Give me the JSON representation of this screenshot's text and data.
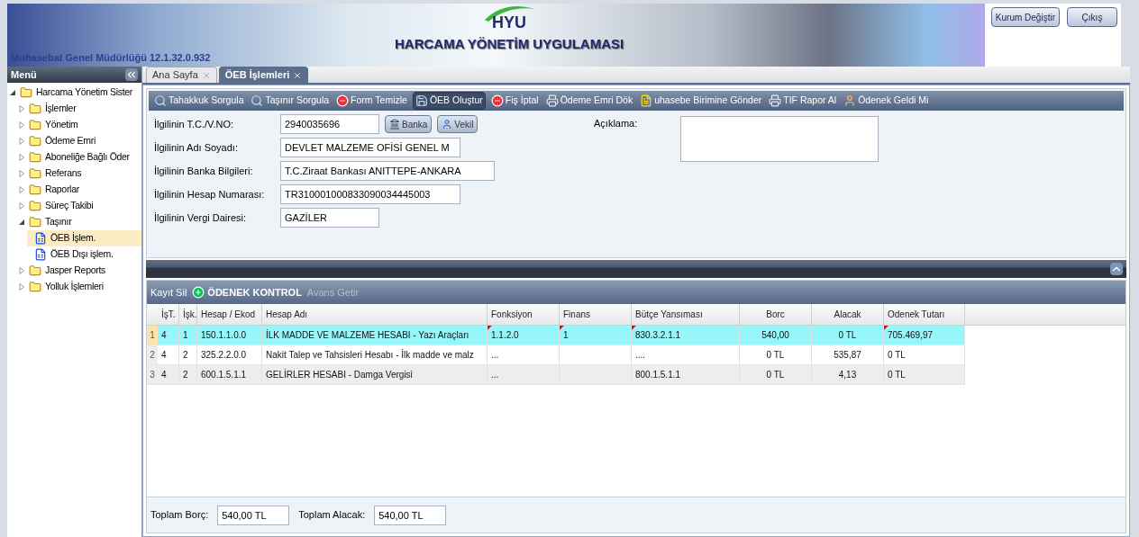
{
  "header": {
    "org": "Muhasebat Genel Müdürlüğü 12.1.32.0.932",
    "logo": "HYU",
    "title": "HARCAMA YÖNETİM UYGULAMASI",
    "buttons": [
      "Kurum Değiştir",
      "Çıkış"
    ]
  },
  "sidebar": {
    "title": "Menü",
    "items": [
      {
        "label": "Harcama Yönetim Sister",
        "expanded": true,
        "selected": false,
        "children": [
          {
            "label": "İşlemler",
            "expanded": false,
            "selected": false
          },
          {
            "label": "Yönetim",
            "expanded": false,
            "selected": false
          },
          {
            "label": "Ödeme Emri",
            "expanded": false,
            "selected": false
          },
          {
            "label": "Aboneliğe Bağlı Öder",
            "expanded": false,
            "selected": false
          },
          {
            "label": "Referans",
            "expanded": false,
            "selected": false
          },
          {
            "label": "Raporlar",
            "expanded": false,
            "selected": false
          },
          {
            "label": "Süreç Takibi",
            "expanded": false,
            "selected": false
          },
          {
            "label": "Taşınır",
            "expanded": true,
            "selected": false,
            "children": [
              {
                "label": "ÖEB İşlem.",
                "kind": "leaf",
                "selected": true
              },
              {
                "label": "ÖEB Dışı işlem.",
                "kind": "leaf",
                "selected": false
              }
            ]
          },
          {
            "label": "Jasper Reports",
            "expanded": false,
            "selected": false
          },
          {
            "label": "Yolluk İşlemleri",
            "expanded": false,
            "selected": false
          }
        ]
      }
    ]
  },
  "tabs": [
    {
      "label": "Ana Sayfa",
      "selected": false
    },
    {
      "label": "ÖEB İşlemleri",
      "selected": true
    }
  ],
  "toolbar": [
    {
      "label": "Tahakkuk Sorgula",
      "kind": "search",
      "selected": false
    },
    {
      "label": "Taşınır Sorgula",
      "kind": "search",
      "selected": false
    },
    {
      "label": "Form Temizle",
      "kind": "remove",
      "selected": false
    },
    {
      "label": "ÖEB Oluştur",
      "kind": "save",
      "selected": true
    },
    {
      "label": "Fiş İptal",
      "kind": "remove",
      "selected": false
    },
    {
      "label": "Ödeme Emri Dök",
      "kind": "print",
      "selected": false
    },
    {
      "label": "uhasebe Birimine Gönder",
      "kind": "document",
      "selected": false
    },
    {
      "label": "TIF Rapor Al",
      "kind": "print",
      "selected": false
    },
    {
      "label": "Ödenek Geldi Mi",
      "kind": "person",
      "selected": false
    }
  ],
  "form": {
    "fields": [
      {
        "label": "İlgilinin T.C./V.NO:",
        "value": "2940035696"
      },
      {
        "label": "İlgilinin Adı Soyadı:",
        "value": "DEVLET MALZEME OFİSİ GENEL M"
      },
      {
        "label": "İlgilinin Banka Bilgileri:",
        "value": "T.C.Ziraat Bankası ANITTEPE-ANKARA"
      },
      {
        "label": "İlgilinin Hesap Numarası:",
        "value": "TR310001000833090034445003"
      },
      {
        "label": "İlgilinin Vergi Dairesi:",
        "value": "GAZİLER"
      }
    ],
    "field_buttons": [
      {
        "label": "Banka",
        "kind": "bank"
      },
      {
        "label": "Vekil",
        "kind": "person"
      }
    ],
    "note": {
      "label": "Açıklama:"
    }
  },
  "grid_toolbar": [
    {
      "label": "Kayıt Sil",
      "kind": "text",
      "disabled": false
    },
    {
      "label": "ÖDENEK KONTROL",
      "kind": "add",
      "disabled": false
    },
    {
      "label": "Avans Getir",
      "kind": "text",
      "disabled": true
    }
  ],
  "table": {
    "columns": [
      "İşT.",
      "İşk.",
      "Hesap / Ekod",
      "Hesap Adı",
      "Fonksiyon",
      "Finans",
      "Bütçe Yansıması",
      "Borc",
      "Alacak",
      "Odenek Tutarı"
    ],
    "rows": [
      {
        "number": "1",
        "selected": true,
        "cells": [
          {
            "text": "4",
            "modified": false
          },
          {
            "text": "1",
            "modified": false
          },
          {
            "text": "150.1.1.0.0",
            "modified": false
          },
          {
            "text": "İLK MADDE VE MALZEME HESABI - Yazı Araçları",
            "modified": false
          },
          {
            "text": "1.1.2.0",
            "modified": true
          },
          {
            "text": "1",
            "modified": true
          },
          {
            "text": "830.3.2.1.1",
            "modified": true
          },
          {
            "text": "540,00",
            "modified": false
          },
          {
            "text": "0 TL",
            "modified": false
          },
          {
            "text": "705.469,97",
            "modified": true
          }
        ]
      },
      {
        "number": "2",
        "selected": false,
        "cells": [
          {
            "text": "4",
            "modified": false
          },
          {
            "text": "2",
            "modified": false
          },
          {
            "text": "325.2.2.0.0",
            "modified": false
          },
          {
            "text": "Nakit Talep ve Tahsisleri Hesabı - İlk madde ve malz",
            "modified": false
          },
          {
            "text": "...",
            "modified": false
          },
          {
            "text": "",
            "modified": false
          },
          {
            "text": "....",
            "modified": false
          },
          {
            "text": "0 TL",
            "modified": false
          },
          {
            "text": "535,87",
            "modified": false
          },
          {
            "text": "0 TL",
            "modified": false
          }
        ]
      },
      {
        "number": "3",
        "selected": false,
        "cells": [
          {
            "text": "4",
            "modified": false
          },
          {
            "text": "2",
            "modified": false
          },
          {
            "text": "600.1.5.1.1",
            "modified": false
          },
          {
            "text": "GELİRLER HESABI - Damga Vergisi",
            "modified": false
          },
          {
            "text": "...",
            "modified": false
          },
          {
            "text": "",
            "modified": false
          },
          {
            "text": "800.1.5.1.1",
            "modified": false
          },
          {
            "text": "0 TL",
            "modified": false
          },
          {
            "text": "4,13",
            "modified": false
          },
          {
            "text": "0 TL",
            "modified": false
          }
        ]
      }
    ]
  },
  "totals": [
    {
      "label": "Toplam Borç:",
      "value": "540,00 TL"
    },
    {
      "label": "Toplam Alacak:",
      "value": "540,00 TL"
    }
  ]
}
